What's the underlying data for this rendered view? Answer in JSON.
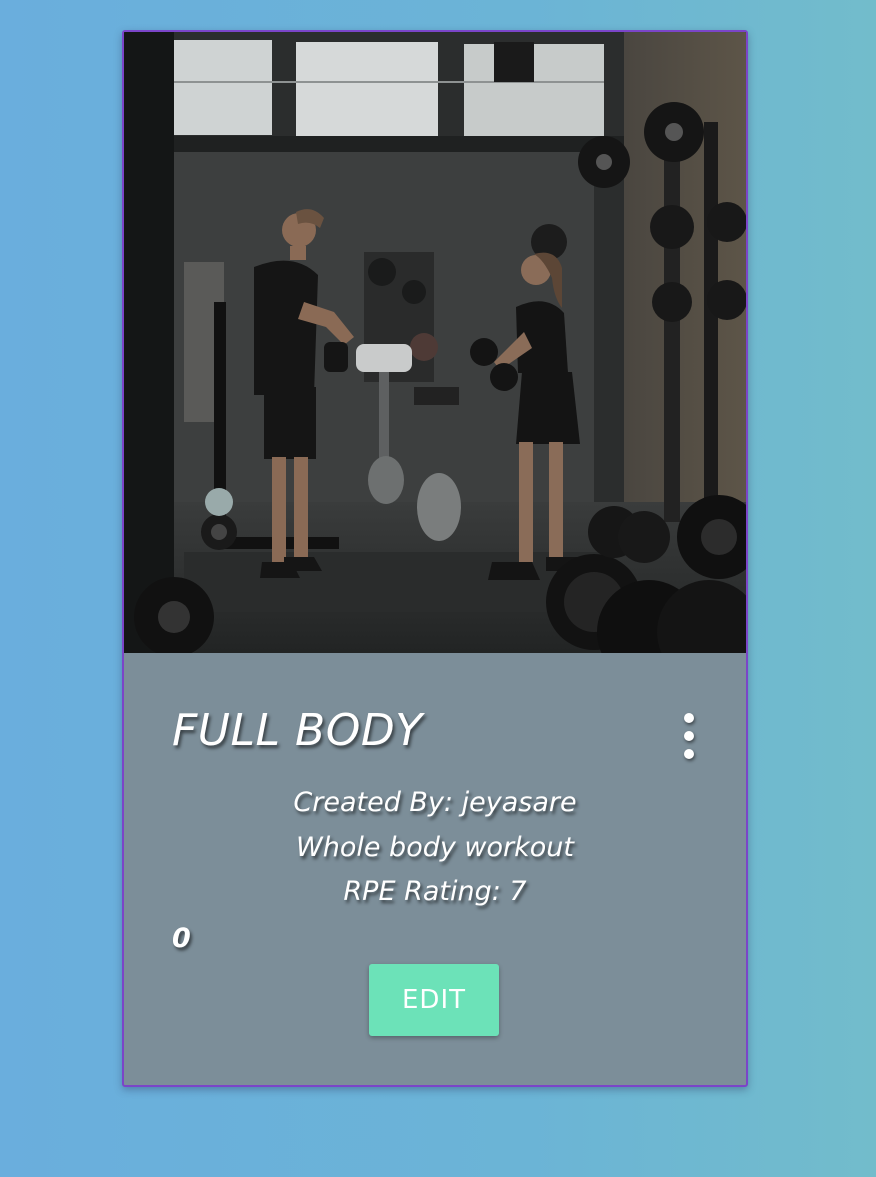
{
  "card": {
    "title": "FULL BODY",
    "created_by": "Created By: jeyasare",
    "description": "Whole body workout",
    "rpe": "RPE Rating: 7",
    "count": "0",
    "edit_label": "EDIT",
    "menu_icon": "more-vertical-icon",
    "image": "gym-photo"
  },
  "colors": {
    "card_border": "#7b45c8",
    "card_body": "#7c8e99",
    "edit_button": "#6ce2b8",
    "background_start": "#6aaedd",
    "background_end": "#72bccb"
  }
}
